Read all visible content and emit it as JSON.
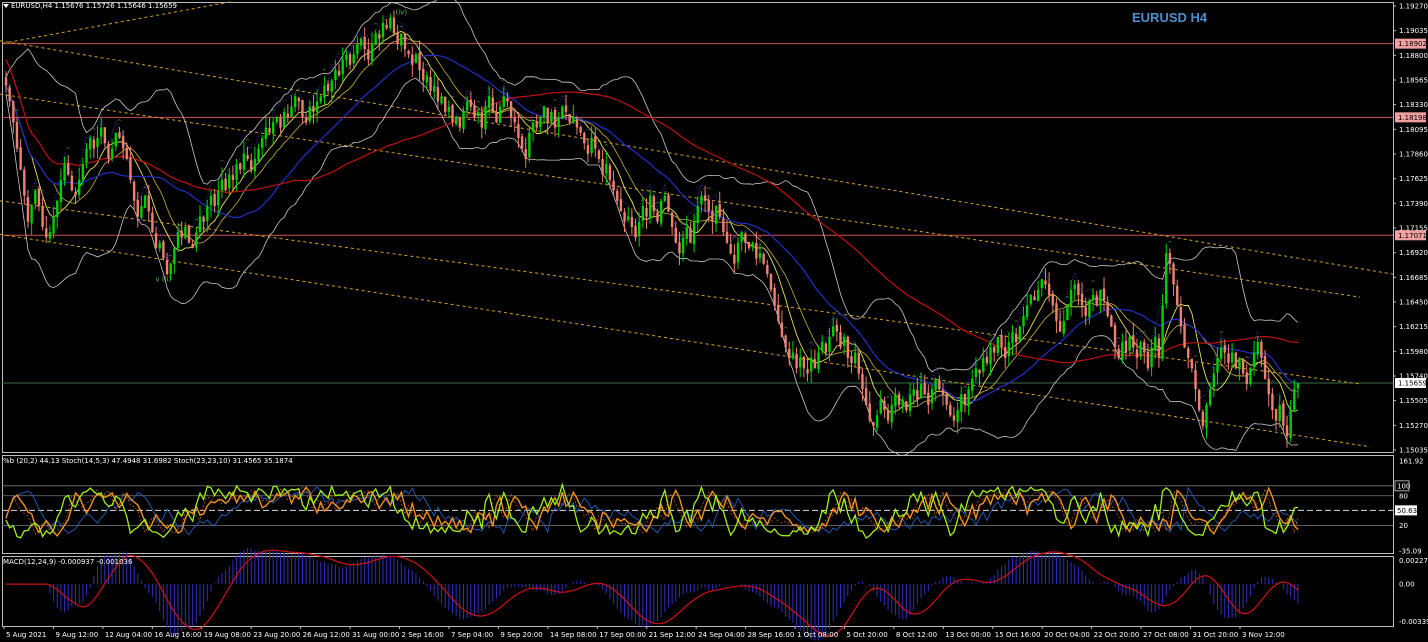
{
  "header": {
    "symbol_line": "EURUSD,H4  1.15676 1.15726 1.15646 1.15659",
    "watermark": "EURUSD H4"
  },
  "colors": {
    "background": "#000000",
    "bull_candle": "#00d000",
    "bear_candle": "#f08070",
    "bollinger": "#c8c8c8",
    "ma_fast": "#e8e05a",
    "ma_mid": "#2030c8",
    "ma_slow": "#c01010",
    "channel": "#d8a020",
    "h_level": "#d05050",
    "stoch_main": "#a0f020",
    "stoch_slow": "#f09020",
    "macd_hist": "#3030c0",
    "macd_signal": "#d01010"
  },
  "chart_data": [
    {
      "type": "candlestick",
      "name": "main",
      "y_ticks": [
        "1.19270",
        "1.19035",
        "1.18800",
        "1.18565",
        "1.18330",
        "1.18095",
        "1.17860",
        "1.17625",
        "1.17390",
        "1.17155",
        "1.16920",
        "1.16685",
        "1.16450",
        "1.16215",
        "1.15980",
        "1.15740",
        "1.15505",
        "1.15270",
        "1.15035"
      ],
      "ylim": [
        1.15,
        1.193
      ],
      "price_labels": [
        {
          "value": 1.18902,
          "label": "1.18902"
        },
        {
          "value": 1.18198,
          "label": "1.18198"
        },
        {
          "value": 1.17071,
          "label": "1.17071"
        },
        {
          "value": 1.15659,
          "label": "1.15659"
        }
      ],
      "wave_labels": [
        {
          "label": "(iv)",
          "bar": 108,
          "price": 1.1918
        },
        {
          "label": "v (ii)",
          "bar": 43,
          "price": 1.1663
        }
      ],
      "path": [
        1.185,
        1.1835,
        1.1815,
        1.179,
        1.177,
        1.1745,
        1.172,
        1.1735,
        1.175,
        1.1735,
        1.1715,
        1.1705,
        1.171,
        1.1725,
        1.174,
        1.176,
        1.1775,
        1.1765,
        1.175,
        1.1745,
        1.176,
        1.1775,
        1.179,
        1.18,
        1.179,
        1.18,
        1.181,
        1.1795,
        1.178,
        1.179,
        1.1805,
        1.18,
        1.179,
        1.178,
        1.176,
        1.174,
        1.1725,
        1.1735,
        1.1745,
        1.173,
        1.171,
        1.1695,
        1.17,
        1.1685,
        1.167,
        1.168,
        1.1695,
        1.171,
        1.1705,
        1.1715,
        1.17,
        1.1695,
        1.171,
        1.1725,
        1.172,
        1.1735,
        1.1745,
        1.1735,
        1.175,
        1.176,
        1.175,
        1.1765,
        1.176,
        1.1775,
        1.177,
        1.1785,
        1.178,
        1.177,
        1.178,
        1.179,
        1.18,
        1.181,
        1.1805,
        1.1815,
        1.182,
        1.181,
        1.1825,
        1.182,
        1.183,
        1.184,
        1.1835,
        1.182,
        1.1815,
        1.183,
        1.1825,
        1.1835,
        1.184,
        1.185,
        1.1845,
        1.1855,
        1.1865,
        1.186,
        1.1875,
        1.188,
        1.187,
        1.188,
        1.189,
        1.1895,
        1.1885,
        1.1875,
        1.189,
        1.19,
        1.1895,
        1.191,
        1.1905,
        1.1915,
        1.19,
        1.189,
        1.19,
        1.1885,
        1.188,
        1.187,
        1.188,
        1.1865,
        1.1855,
        1.186,
        1.1845,
        1.185,
        1.1835,
        1.184,
        1.1825,
        1.183,
        1.1815,
        1.182,
        1.181,
        1.1825,
        1.1835,
        1.183,
        1.182,
        1.1825,
        1.181,
        1.183,
        1.184,
        1.1825,
        1.1815,
        1.183,
        1.184,
        1.1835,
        1.182,
        1.1815,
        1.18,
        1.179,
        1.178,
        1.1805,
        1.1815,
        1.181,
        1.182,
        1.183,
        1.1815,
        1.1825,
        1.181,
        1.182,
        1.183,
        1.1825,
        1.1815,
        1.182,
        1.181,
        1.1805,
        1.1795,
        1.1785,
        1.18,
        1.179,
        1.178,
        1.1765,
        1.1775,
        1.176,
        1.175,
        1.174,
        1.173,
        1.172,
        1.1725,
        1.1715,
        1.1705,
        1.172,
        1.1735,
        1.1725,
        1.1745,
        1.173,
        1.172,
        1.174,
        1.1745,
        1.173,
        1.1715,
        1.17,
        1.169,
        1.1705,
        1.1715,
        1.17,
        1.172,
        1.1735,
        1.1745,
        1.174,
        1.173,
        1.172,
        1.1735,
        1.1725,
        1.171,
        1.17,
        1.169,
        1.168,
        1.17,
        1.171,
        1.17,
        1.1695,
        1.17,
        1.1685,
        1.169,
        1.168,
        1.167,
        1.1655,
        1.164,
        1.1625,
        1.161,
        1.16,
        1.159,
        1.1595,
        1.158,
        1.159,
        1.158,
        1.1575,
        1.159,
        1.158,
        1.1595,
        1.1605,
        1.1595,
        1.161,
        1.162,
        1.1615,
        1.16,
        1.161,
        1.159,
        1.1585,
        1.1595,
        1.1575,
        1.156,
        1.1545,
        1.153,
        1.1525,
        1.1535,
        1.155,
        1.154,
        1.153,
        1.1545,
        1.1555,
        1.1545,
        1.155,
        1.154,
        1.1555,
        1.156,
        1.155,
        1.1565,
        1.1555,
        1.1545,
        1.156,
        1.157,
        1.156,
        1.1555,
        1.1545,
        1.1535,
        1.153,
        1.154,
        1.1555,
        1.1545,
        1.156,
        1.157,
        1.158,
        1.1575,
        1.159,
        1.1585,
        1.16,
        1.1595,
        1.161,
        1.16,
        1.159,
        1.1605,
        1.1615,
        1.1605,
        1.162,
        1.163,
        1.164,
        1.165,
        1.1645,
        1.1655,
        1.1665,
        1.166,
        1.165,
        1.164,
        1.1625,
        1.1615,
        1.1625,
        1.164,
        1.1655,
        1.166,
        1.165,
        1.164,
        1.163,
        1.1645,
        1.165,
        1.164,
        1.1655,
        1.1645,
        1.163,
        1.162,
        1.16,
        1.159,
        1.1605,
        1.1595,
        1.161,
        1.16,
        1.159,
        1.1605,
        1.1595,
        1.158,
        1.16,
        1.161,
        1.159,
        1.164,
        1.169,
        1.168,
        1.166,
        1.164,
        1.162,
        1.16,
        1.159,
        1.158,
        1.156,
        1.154,
        1.1525,
        1.1545,
        1.156,
        1.1575,
        1.159,
        1.16,
        1.1595,
        1.1585,
        1.1595,
        1.158,
        1.159,
        1.1575,
        1.1565,
        1.158,
        1.1595,
        1.1605,
        1.159,
        1.157,
        1.1555,
        1.154,
        1.153,
        1.1545,
        1.1525,
        1.1515,
        1.154,
        1.156,
        1.1566
      ]
    },
    {
      "type": "line",
      "name": "oscillator",
      "header": "%b (20,2) 44.13   Stoch(14,5,3) 47.4948 31.6982   Stoch(23,23,10) 31.4565 35.1874",
      "y_ticks": [
        "161.92",
        "80",
        "100",
        "50.63",
        "20",
        "-35.09"
      ],
      "ylim": [
        -35.09,
        161.92
      ]
    },
    {
      "type": "bar",
      "name": "macd",
      "header": "MACD(12,24,9) -0.000937 -0.001036",
      "y_ticks": [
        "0.002271",
        "0.00",
        "-0.003393"
      ],
      "ylim": [
        -0.003393,
        0.002271
      ]
    }
  ],
  "time_axis": [
    "5 Aug 2021",
    "9 Aug 12:00",
    "12 Aug 04:00",
    "16 Aug 16:00",
    "19 Aug 08:00",
    "23 Aug 20:00",
    "26 Aug 12:00",
    "31 Aug 00:00",
    "2 Sep 16:00",
    "7 Sep 04:00",
    "9 Sep 20:00",
    "14 Sep 08:00",
    "17 Sep 00:00",
    "21 Sep 12:00",
    "24 Sep 04:00",
    "28 Sep 16:00",
    "1 Oct 08:00",
    "5 Oct 20:00",
    "8 Oct 12:00",
    "13 Oct 00:00",
    "15 Oct 16:00",
    "20 Oct 04:00",
    "22 Oct 20:00",
    "27 Oct 08:00",
    "31 Oct 20:00",
    "3 Nov 12:00"
  ]
}
